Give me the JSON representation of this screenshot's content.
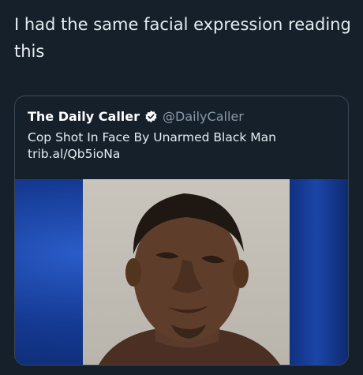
{
  "tweet": {
    "text": "I had the same facial expression reading this"
  },
  "quote": {
    "account_name": "The Daily Caller",
    "verified_icon": "verified-badge-icon",
    "handle": "@DailyCaller",
    "headline": "Cop Shot In Face By Unarmed Black Man",
    "link": "trib.al/Qb5ioNa"
  },
  "colors": {
    "background": "#16202b",
    "text": "#e6ecf0",
    "handle": "#8899a6",
    "verified": "#ffffff"
  }
}
